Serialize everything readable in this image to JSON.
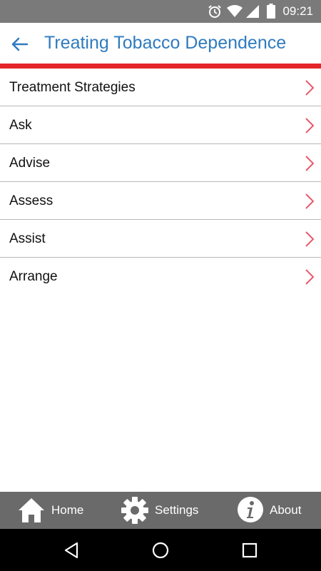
{
  "status_bar": {
    "time": "09:21",
    "icons": [
      "alarm-icon",
      "wifi-icon",
      "signal-icon",
      "battery-icon"
    ]
  },
  "header": {
    "title": "Treating Tobacco Dependence",
    "back_icon": "arrow-left-icon",
    "title_color": "#2f7bbf",
    "accent_color": "#e4262a"
  },
  "menu": {
    "items": [
      {
        "label": "Treatment Strategies"
      },
      {
        "label": "Ask"
      },
      {
        "label": "Advise"
      },
      {
        "label": "Assess"
      },
      {
        "label": "Assist"
      },
      {
        "label": "Arrange"
      }
    ],
    "chevron_icon": "chevron-right-icon",
    "chevron_color": "#e85a6b"
  },
  "bottom_nav": {
    "home": "Home",
    "settings": "Settings",
    "about": "About",
    "background": "#6a6a6a"
  },
  "system_nav": {
    "icons": [
      "back-triangle-icon",
      "home-circle-icon",
      "recents-square-icon"
    ]
  }
}
